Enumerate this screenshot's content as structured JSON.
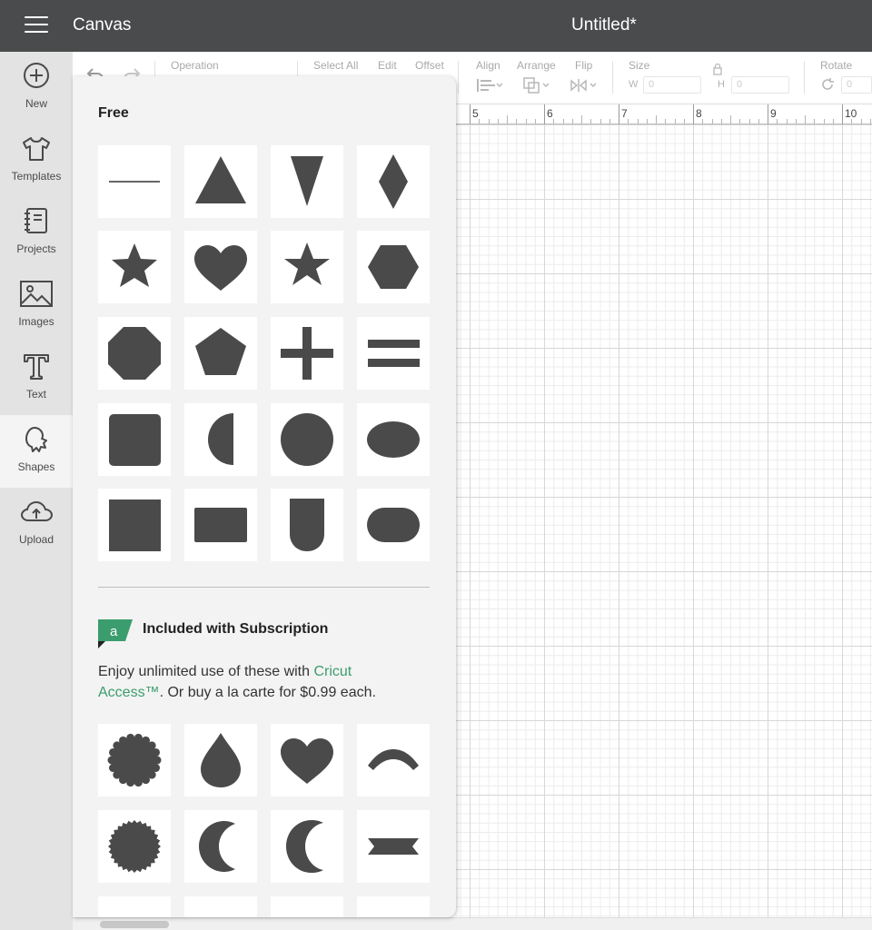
{
  "header": {
    "app_title": "Canvas",
    "document_title": "Untitled*"
  },
  "nav": {
    "items": [
      {
        "label": "New",
        "icon": "plus-circle-icon"
      },
      {
        "label": "Templates",
        "icon": "tshirt-icon"
      },
      {
        "label": "Projects",
        "icon": "notebook-icon"
      },
      {
        "label": "Images",
        "icon": "image-icon"
      },
      {
        "label": "Text",
        "icon": "text-t-icon"
      },
      {
        "label": "Shapes",
        "icon": "shapes-icon",
        "active": true
      },
      {
        "label": "Upload",
        "icon": "cloud-upload-icon"
      }
    ]
  },
  "toolbar": {
    "operation_label": "Operation",
    "select_all_label": "Select All",
    "edit_label": "Edit",
    "offset_label": "Offset",
    "align_label": "Align",
    "arrange_label": "Arrange",
    "flip_label": "Flip",
    "size_label": "Size",
    "w_label": "W",
    "w_value": "0",
    "h_label": "H",
    "h_value": "0",
    "rotate_label": "Rotate",
    "rotate_value": "0"
  },
  "ruler": {
    "ticks": [
      "5",
      "6",
      "7",
      "8",
      "9",
      "10"
    ]
  },
  "panel": {
    "free_heading": "Free",
    "free_shapes": [
      "line",
      "triangle",
      "inverted-triangle",
      "diamond",
      "star",
      "heart",
      "star-small",
      "hexagon",
      "octagon",
      "pentagon",
      "plus",
      "equals",
      "rounded-square",
      "half-circle",
      "circle",
      "oval",
      "square",
      "rectangle",
      "arch",
      "pill"
    ],
    "subscription_heading": "Included with Subscription",
    "subscription_badge": "a",
    "subscription_text_before": "Enjoy unlimited use of these with ",
    "subscription_link": "Cricut Access™",
    "subscription_text_after": ". Or buy a la carte for $0.99 each.",
    "premium_shapes": [
      "scalloped-circle",
      "teardrop",
      "heart",
      "arc",
      "starburst-seal",
      "crescent-left",
      "crescent-right",
      "ribbon-banner"
    ]
  },
  "colors": {
    "header_bg": "#4a4b4d",
    "shape_fill": "#4a4a4a",
    "accent_green": "#3b9d6d"
  }
}
